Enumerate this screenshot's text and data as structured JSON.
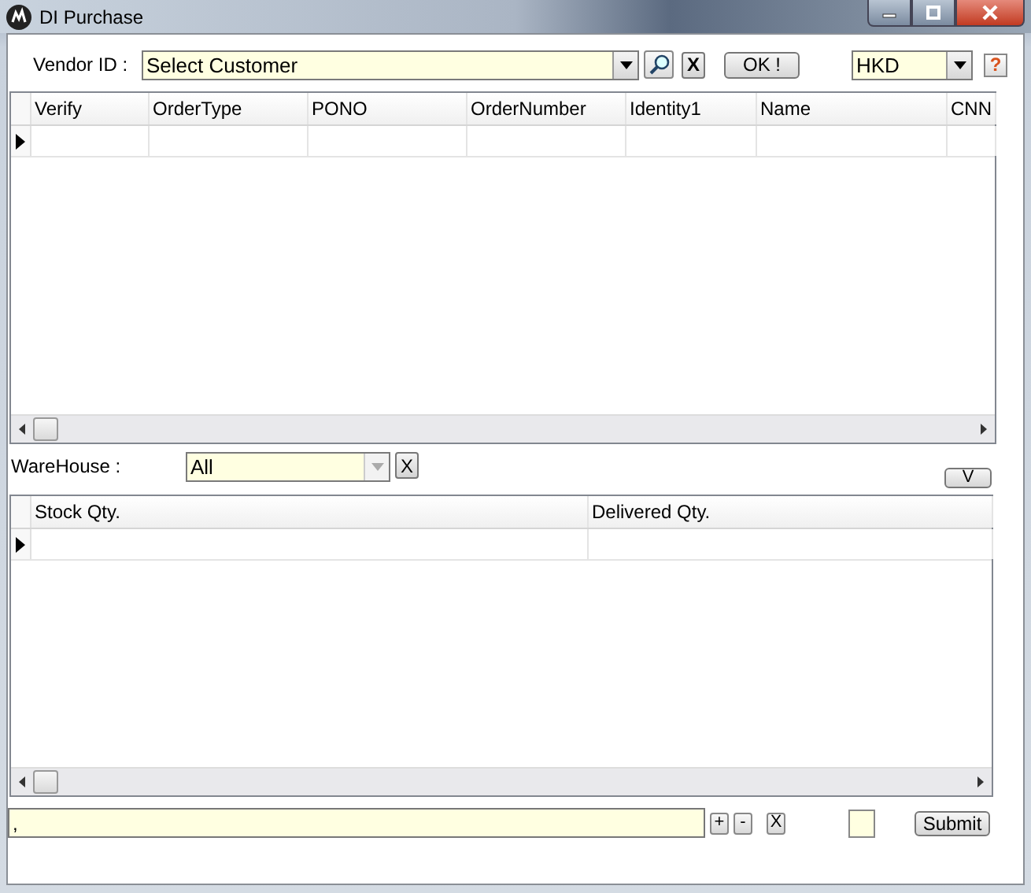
{
  "window": {
    "title": "DI Purchase"
  },
  "vendor": {
    "label": "Vendor ID :",
    "value": "Select Customer",
    "clear_button": "X",
    "ok_button": "OK !"
  },
  "currency": {
    "value": "HKD",
    "help_button": "?"
  },
  "orders_grid": {
    "columns": [
      "Verify",
      "OrderType",
      "PONO",
      "OrderNumber",
      "Identity1",
      "Name",
      "CNN"
    ],
    "rows": [
      {
        "selected": true
      }
    ]
  },
  "warehouse": {
    "label": "WareHouse :",
    "value": "All",
    "disabled_arrow": true,
    "clear_button": "X",
    "toggle_button": "V"
  },
  "stock_grid": {
    "columns": [
      "Stock Qty.",
      "Delivered Qty."
    ],
    "rows": [
      {
        "selected": true
      }
    ]
  },
  "footer": {
    "value": ",",
    "plus_button": "+",
    "minus_button": "-",
    "clear_button": "X",
    "submit_button": "Submit"
  }
}
